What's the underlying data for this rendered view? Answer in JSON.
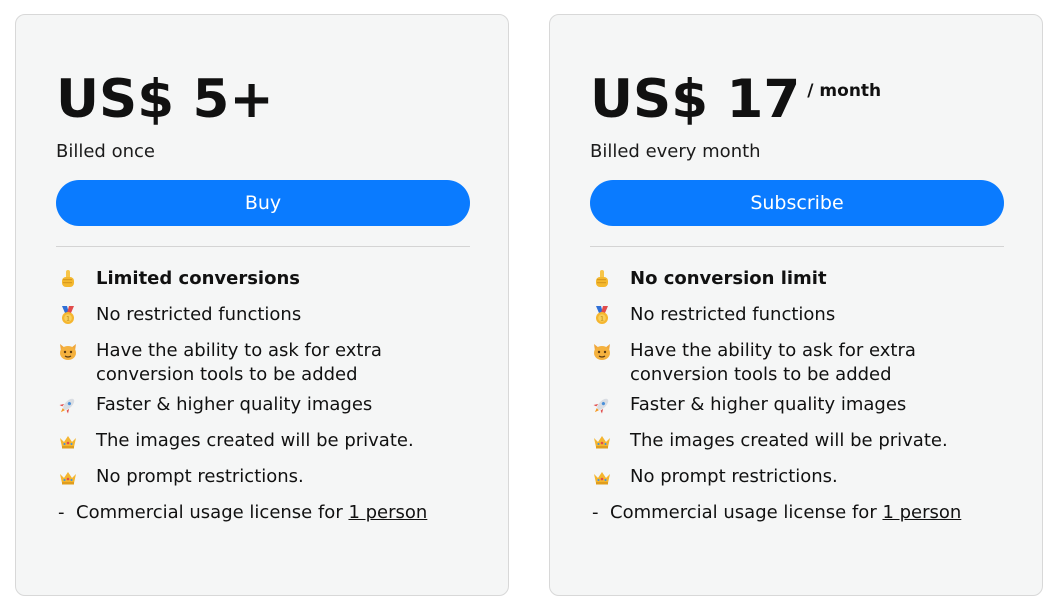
{
  "plans": [
    {
      "price": "US$ 5+",
      "period": "",
      "billing": "Billed once",
      "cta_label": "Buy",
      "features": [
        {
          "icon": "pointing-finger-icon",
          "text": "Limited conversions",
          "bold": true
        },
        {
          "icon": "medal-icon",
          "text": "No restricted functions",
          "bold": false
        },
        {
          "icon": "cat-face-icon",
          "text": "Have the ability to ask for extra conversion tools to be added",
          "bold": false
        },
        {
          "icon": "rocket-icon",
          "text": "Faster & higher quality images",
          "bold": false
        },
        {
          "icon": "crown-icon",
          "text": "The images created will be private.",
          "bold": false
        },
        {
          "icon": "crown-icon",
          "text": "No prompt restrictions.",
          "bold": false
        }
      ],
      "license": {
        "prefix": "Commercial usage license for ",
        "link": "1 person"
      }
    },
    {
      "price": "US$ 17",
      "period": "/ month",
      "billing": "Billed every month",
      "cta_label": "Subscribe",
      "features": [
        {
          "icon": "pointing-finger-icon",
          "text": "No conversion limit",
          "bold": true
        },
        {
          "icon": "medal-icon",
          "text": "No restricted functions",
          "bold": false
        },
        {
          "icon": "cat-face-icon",
          "text": "Have the ability to ask for extra conversion tools to be added",
          "bold": false
        },
        {
          "icon": "rocket-icon",
          "text": "Faster & higher quality images",
          "bold": false
        },
        {
          "icon": "crown-icon",
          "text": "The images created will be private.",
          "bold": false
        },
        {
          "icon": "crown-icon",
          "text": "No prompt restrictions.",
          "bold": false
        }
      ],
      "license": {
        "prefix": "Commercial usage license for ",
        "link": "1 person"
      }
    }
  ],
  "colors": {
    "accent": "#0a7bff",
    "card_bg": "#f5f6f6",
    "border": "#d8d8d8"
  }
}
